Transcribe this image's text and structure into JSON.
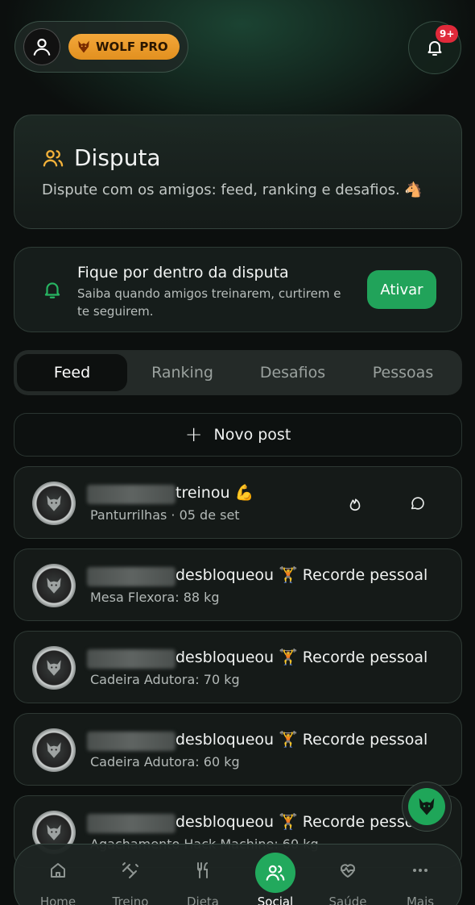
{
  "header": {
    "badge_label": "WOLF PRO",
    "notification_count": "9+"
  },
  "disputa": {
    "title": "Disputa",
    "subtitle": "Dispute com os amigos: feed, ranking e desafios. 🐴"
  },
  "notify": {
    "title": "Fique por dentro da disputa",
    "subtitle": "Saiba quando amigos treinarem, curtirem e te seguirem.",
    "button_label": "Ativar"
  },
  "tabs": [
    {
      "label": "Feed",
      "active": true
    },
    {
      "label": "Ranking",
      "active": false
    },
    {
      "label": "Desafios",
      "active": false
    },
    {
      "label": "Pessoas",
      "active": false
    }
  ],
  "new_post_label": "Novo post",
  "feed": [
    {
      "action": "treinou 💪",
      "detail": "Panturrilhas · 05 de set"
    },
    {
      "action": "desbloqueou 🏋️ Recorde pessoal",
      "detail": "Mesa Flexora: 88 kg"
    },
    {
      "action": "desbloqueou 🏋️ Recorde pessoal",
      "detail": "Cadeira Adutora: 70 kg"
    },
    {
      "action": "desbloqueou 🏋️ Recorde pessoal",
      "detail": "Cadeira Adutora: 60 kg"
    },
    {
      "action": "desbloqueou 🏋️ Recorde pessoal",
      "detail": "Agachamento Hack Machine: 60 kg"
    }
  ],
  "nav": [
    {
      "label": "Home",
      "icon": "home-icon"
    },
    {
      "label": "Treino",
      "icon": "dumbbell-icon"
    },
    {
      "label": "Dieta",
      "icon": "utensils-icon"
    },
    {
      "label": "Social",
      "icon": "users-icon",
      "active": true
    },
    {
      "label": "Saúde",
      "icon": "heart-pulse-icon"
    },
    {
      "label": "Mais",
      "icon": "more-icon"
    }
  ],
  "colors": {
    "accent_green": "#21a35a",
    "badge_orange": "#f0a030",
    "notification_red": "#e02a3a"
  }
}
